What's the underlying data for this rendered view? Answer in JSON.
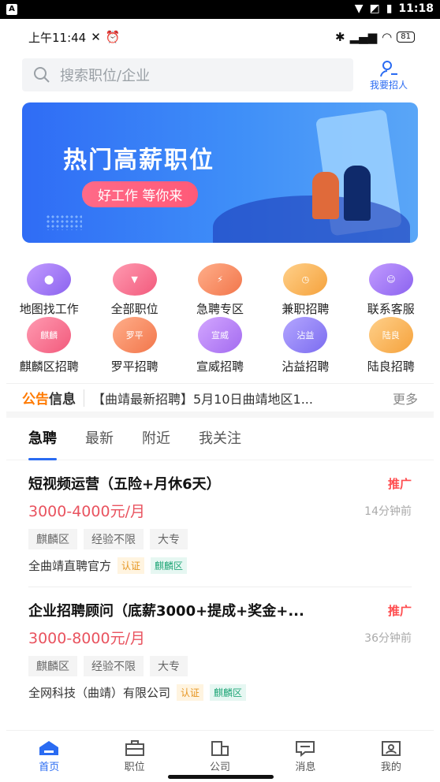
{
  "system_bar": {
    "badge": "A",
    "time": "11:18"
  },
  "status": {
    "time": "上午11:44",
    "battery": "81"
  },
  "search": {
    "placeholder": "搜索职位/企业",
    "recruit_label": "我要招人"
  },
  "banner": {
    "title": "热门高薪职位",
    "subtitle": "好工作 等你来"
  },
  "categories": [
    {
      "label": "地图找工作",
      "icon": "map-pin-icon",
      "color": "#a77bf2"
    },
    {
      "label": "全部职位",
      "icon": "tie-icon",
      "color": "#f86a8a"
    },
    {
      "label": "急聘专区",
      "icon": "briefcase-icon",
      "color": "#f6895f"
    },
    {
      "label": "兼职招聘",
      "icon": "clock-icon",
      "color": "#f6a848"
    },
    {
      "label": "联系客服",
      "icon": "service-icon",
      "color": "#a77bf2"
    }
  ],
  "districts": [
    {
      "label": "麒麟区招聘",
      "short": "麒麟",
      "color": "#f86a8a"
    },
    {
      "label": "罗平招聘",
      "short": "罗平",
      "color": "#f6895f"
    },
    {
      "label": "宣威招聘",
      "short": "宣威",
      "color": "#b27cf0"
    },
    {
      "label": "沾益招聘",
      "short": "沾益",
      "color": "#8d7cf2"
    },
    {
      "label": "陆良招聘",
      "short": "陆良",
      "color": "#f6a848"
    }
  ],
  "notice": {
    "logo_a": "公告",
    "logo_b": "信息",
    "text": "【曲靖最新招聘】5月10日曲靖地区1...",
    "more": "更多"
  },
  "tabs": [
    "急聘",
    "最新",
    "附近",
    "我关注"
  ],
  "jobs": [
    {
      "title": "短视频运营（五险+月休6天）",
      "promo": "推广",
      "salary": "3000-4000元/月",
      "time": "14分钟前",
      "tags": [
        "麒麟区",
        "经验不限",
        "大专"
      ],
      "company": "全曲靖直聘官方",
      "badges": [
        "认证",
        "麒麟区"
      ]
    },
    {
      "title": "企业招聘顾问（底薪3000+提成+奖金+...",
      "promo": "推广",
      "salary": "3000-8000元/月",
      "time": "36分钟前",
      "tags": [
        "麒麟区",
        "经验不限",
        "大专"
      ],
      "company": "全网科技（曲靖）有限公司",
      "badges": [
        "认证",
        "麒麟区"
      ]
    }
  ],
  "nav": [
    {
      "label": "首页",
      "icon": "home-icon"
    },
    {
      "label": "职位",
      "icon": "briefcase-icon"
    },
    {
      "label": "公司",
      "icon": "building-icon"
    },
    {
      "label": "消息",
      "icon": "message-icon"
    },
    {
      "label": "我的",
      "icon": "profile-icon"
    }
  ]
}
